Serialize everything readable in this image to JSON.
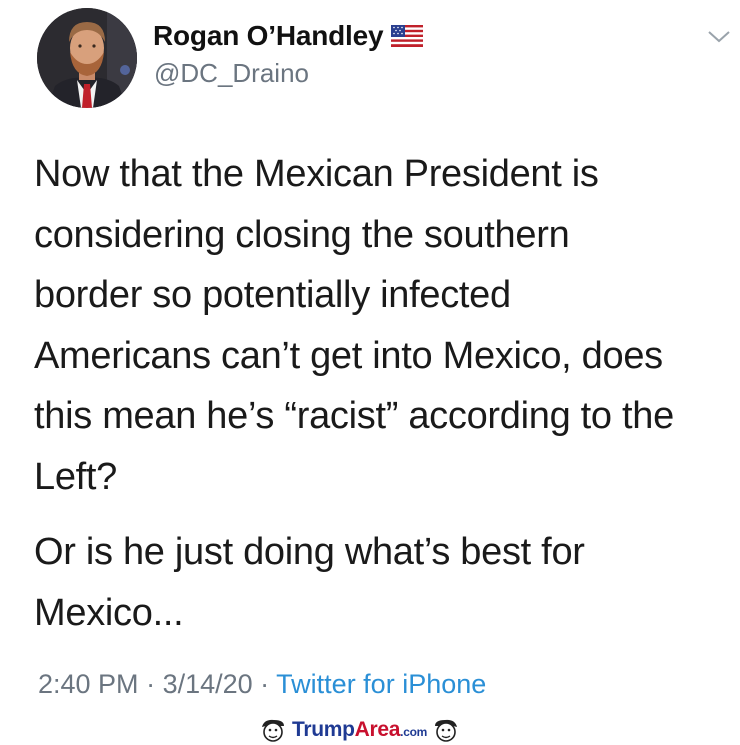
{
  "author": {
    "display_name": "Rogan O’Handley",
    "handle": "@DC_Draino",
    "flag_icon": "us-flag-icon"
  },
  "tweet": {
    "paragraph_1_lines": [
      "Now that the Mexican President is",
      "considering closing the southern",
      "border so potentially infected",
      "Americans can’t get into Mexico, does",
      "this mean he’s “racist” according to the",
      "Left?"
    ],
    "paragraph_2_lines": [
      "Or is he just doing what’s best for",
      "Mexico..."
    ]
  },
  "meta": {
    "time": "2:40 PM",
    "sep1": " · ",
    "date": "3/14/20",
    "sep2": " · ",
    "source": "Twitter for iPhone"
  },
  "watermark": {
    "brand_part1": "Trump",
    "brand_part2": "Area",
    "brand_suffix": ".com"
  },
  "colors": {
    "handle_gray": "#6b7580",
    "link_blue": "#2a8fd6",
    "brand_blue": "#1f3a93",
    "brand_red": "#c8102e"
  }
}
